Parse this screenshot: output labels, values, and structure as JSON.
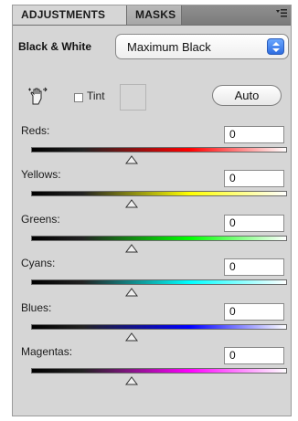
{
  "tabs": [
    {
      "label": "ADJUSTMENTS",
      "active": true
    },
    {
      "label": "MASKS",
      "active": false
    }
  ],
  "panel_menu_icon": "panel-menu-icon",
  "preset": {
    "label": "Black & White",
    "selected": "Maximum Black"
  },
  "tools": {
    "tint_label": "Tint",
    "tint_checked": false,
    "auto_label": "Auto"
  },
  "sliders": [
    {
      "label": "Reds:",
      "value": "0",
      "gradient_end": "#ff0000"
    },
    {
      "label": "Yellows:",
      "value": "0",
      "gradient_end": "#ffff00"
    },
    {
      "label": "Greens:",
      "value": "0",
      "gradient_end": "#00ff00"
    },
    {
      "label": "Cyans:",
      "value": "0",
      "gradient_end": "#00ffff"
    },
    {
      "label": "Blues:",
      "value": "0",
      "gradient_end": "#0000ff"
    },
    {
      "label": "Magentas:",
      "value": "0",
      "gradient_end": "#ff00ff"
    }
  ]
}
